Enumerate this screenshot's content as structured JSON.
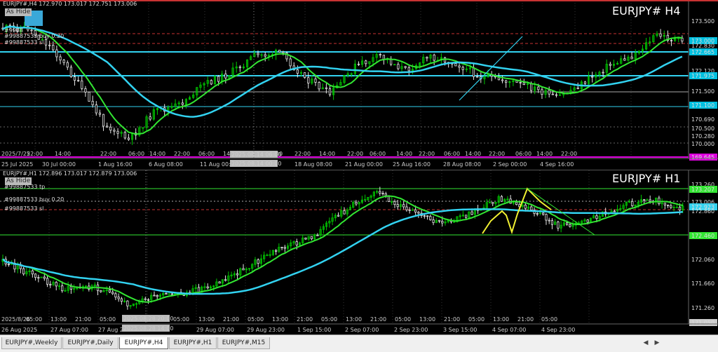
{
  "pane1": {
    "symbol_info": "EURJPY#,H4  172.970 173.017 172.751 173.006",
    "title": "EURJPY# H4",
    "hide_label": "As Hide",
    "order_lines": [
      "#99887533 buy 0.20",
      "#99887533 sl"
    ],
    "order_tag": "#9988",
    "price_labels": [
      "173.500",
      "173.000",
      "172.830",
      "172.665",
      "172.120",
      "171.975",
      "171.500",
      "171.100",
      "170.690",
      "170.500",
      "170.280",
      "170.000",
      "169.645"
    ],
    "time_labels": [
      "25 Jul 2025",
      "30 Jul 00:00",
      "1 Aug 16:00",
      "6 Aug 08:00",
      "11 Aug 00:00",
      "18 Aug 08:00",
      "21 Aug 00:00",
      "25 Aug 16:00",
      "28 Aug 08:00",
      "2 Sep 00:00",
      "4 Sep 16:00"
    ],
    "hour_labels": [
      "2025/7/25",
      "22:00",
      "14:00",
      "22:00",
      "06:00",
      "14:00",
      "22:00",
      "06:00",
      "14:",
      "22:00",
      "14:00",
      "22:00",
      "14:00",
      "22:00",
      "06:00",
      "14:00",
      "22:00",
      "06:00",
      "14:00",
      "22:00",
      "06:00",
      "14:00",
      "22:00"
    ],
    "crosshair_label_top": "2025.08.14 06:00",
    "crosshair_label_bottom": "2025.08.14 00:00"
  },
  "pane2": {
    "symbol_info": "EURJPY#,H1  172.896 173.017 172.879 173.006",
    "title": "EURJPY# H1",
    "hide_label": "As Hide",
    "order_lines": [
      "#99887533 tp",
      "#99887533 buy 0.20",
      "#99887533 sl"
    ],
    "price_labels": [
      "173.260",
      "173.207",
      "173.006",
      "172.923",
      "172.860",
      "172.460",
      "172.060",
      "171.660",
      "171.260",
      "171.050"
    ],
    "time_labels": [
      "26 Aug 2025",
      "27 Aug 07:00",
      "27 Aug 2",
      "29 Aug 07:00",
      "29 Aug 23:00",
      "1 Sep 15:00",
      "2 Sep 07:00",
      "2 Sep 23:00",
      "3 Sep 15:00",
      "4 Sep 07:00",
      "4 Sep 23:00"
    ],
    "hour_labels": [
      "2025/8/26",
      "05:00",
      "13:00",
      "21:00",
      "05:00",
      "13:00",
      "21:00",
      "05:00",
      "13:00",
      "21:00",
      "05:00",
      "13:00",
      "21:00",
      "05:00",
      "13:00",
      "21:00",
      "05:00",
      "13:00",
      "21:00",
      "05:00",
      "13:00",
      "21:00",
      "05:00"
    ],
    "crosshair_label_top": "2025.08.28 20:00",
    "crosshair_label_bottom": "2025.08.28 14:00"
  },
  "tabs": [
    "EURJPY#,Weekly",
    "EURJPY#,Daily",
    "EURJPY#,H4",
    "EURJPY#,H1",
    "EURJPY#,M15"
  ],
  "active_tab": "EURJPY#,H4",
  "colors": {
    "bull": "#00c800",
    "bear": "#e8e8e8",
    "ma_fast": "#32e632",
    "ma_slow": "#32d2f0",
    "trend": "#32e632",
    "zigzag": "#f0f032",
    "order_line": "#c83232",
    "highlight_label": "#00c0e0",
    "magenta": "#e000e0"
  }
}
